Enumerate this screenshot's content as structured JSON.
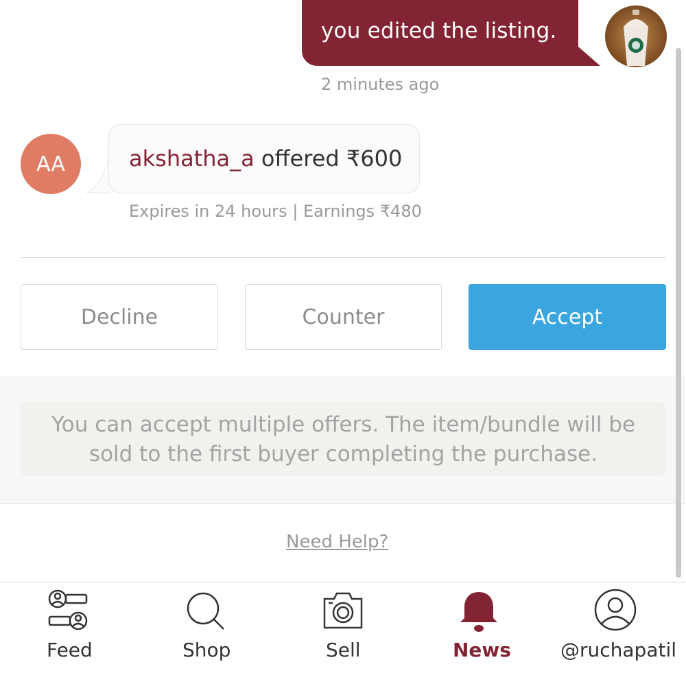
{
  "message": {
    "own_text": "you edited the listing.",
    "timestamp": "2 minutes ago"
  },
  "offer": {
    "avatar_initials": "AA",
    "username": "akshatha_a",
    "action_text": " offered ₹600",
    "subtext": "Expires in 24 hours | Earnings ₹480"
  },
  "actions": {
    "decline": "Decline",
    "counter": "Counter",
    "accept": "Accept"
  },
  "info": {
    "text": "You can accept multiple offers. The item/bundle will be sold to the first buyer completing the purchase."
  },
  "help": {
    "link": "Need Help?"
  },
  "nav": {
    "items": [
      {
        "label": "Feed",
        "icon": "feed-icon"
      },
      {
        "label": "Shop",
        "icon": "search-icon"
      },
      {
        "label": "Sell",
        "icon": "camera-icon"
      },
      {
        "label": "News",
        "icon": "bell-icon",
        "active": true
      },
      {
        "label": "@ruchapatil",
        "icon": "profile-icon"
      }
    ]
  },
  "colors": {
    "brand": "#822434",
    "accept": "#3aa5df",
    "avatar_initials_bg": "#e07b64"
  }
}
